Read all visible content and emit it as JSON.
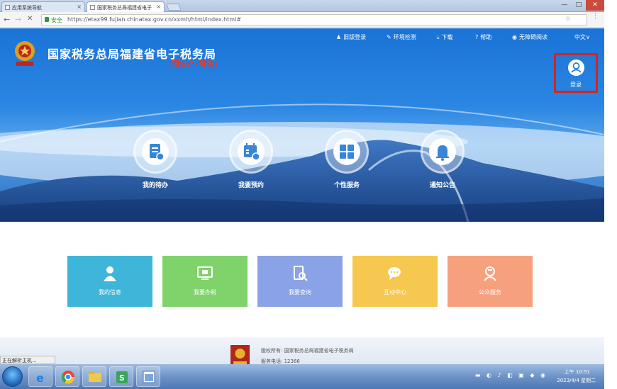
{
  "browser": {
    "tabs": [
      {
        "label": "应用系统导航"
      },
      {
        "label": "国家税务总局福建省电子"
      }
    ],
    "window_controls": [
      "—",
      "□",
      "✕"
    ],
    "back": "←",
    "forward": "→",
    "reload": "✕",
    "secure_label": "安全",
    "url": "https://etax99.fujian.chinatax.gov.cn/xxmh/html/index.html#",
    "star": "☆",
    "menu": "⋮"
  },
  "header": {
    "title": "国家税务总局福建省电子税务局",
    "subtitle": "(预生产-可信)",
    "links": [
      {
        "icon": "person-icon",
        "glyph": "♟",
        "label": "旧版登录"
      },
      {
        "icon": "tools-icon",
        "glyph": "✎",
        "label": "环境检测"
      },
      {
        "icon": "download-icon",
        "glyph": "⤓",
        "label": "下载"
      },
      {
        "icon": "help-icon",
        "glyph": "?",
        "label": "帮助"
      },
      {
        "icon": "eye-icon",
        "glyph": "◉",
        "label": "无障碍阅读"
      },
      {
        "icon": "language-icon",
        "glyph": "",
        "label": "中文∨"
      }
    ],
    "login_label": "登录"
  },
  "quick_entries": [
    {
      "label": "我的待办",
      "icon": "todo-list-icon"
    },
    {
      "label": "我要预约",
      "icon": "calendar-icon"
    },
    {
      "label": "个性服务",
      "icon": "grid-icon"
    },
    {
      "label": "通知公告",
      "icon": "bell-icon"
    }
  ],
  "tiles": [
    {
      "label": "我的信息",
      "icon": "user-icon",
      "color": "#3fb6d9"
    },
    {
      "label": "我要办税",
      "icon": "monitor-icon",
      "color": "#7fd36a"
    },
    {
      "label": "我要查询",
      "icon": "search-document-icon",
      "color": "#8aa2e6"
    },
    {
      "label": "互动中心",
      "icon": "chat-icon",
      "color": "#f6c84f"
    },
    {
      "label": "公众服务",
      "icon": "service-icon",
      "color": "#f7a07e"
    }
  ],
  "footer": {
    "copyright": "版权所有: 国家税务总局福建省电子税务局",
    "hotline": "服务电话: 12366"
  },
  "status_text": "正在解析主机...",
  "taskbar": {
    "apps": [
      "ie-icon",
      "chrome-icon",
      "folder-icon",
      "s-app-icon",
      "window-app-icon"
    ],
    "time": "上午 10:51",
    "date": "2023/4/4 星期二"
  }
}
